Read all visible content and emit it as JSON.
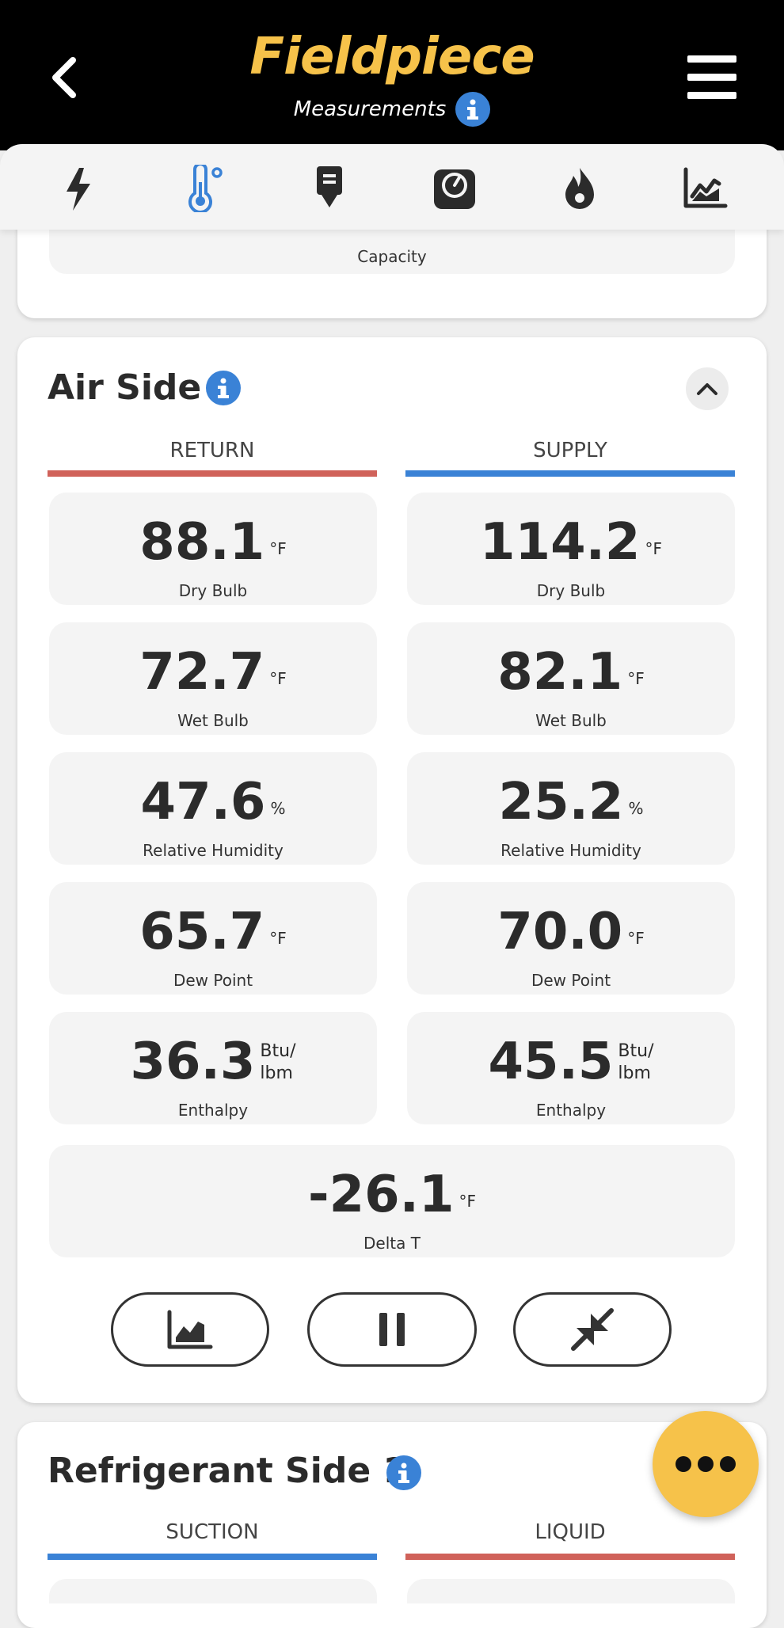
{
  "header": {
    "logo": "Fieldpiece",
    "subtitle": "Measurements"
  },
  "tabs": [
    {
      "icon": "lightning-icon",
      "active": false
    },
    {
      "icon": "thermometer-icon",
      "active": true
    },
    {
      "icon": "download-probe-icon",
      "active": false
    },
    {
      "icon": "gauge-icon",
      "active": false
    },
    {
      "icon": "flame-icon",
      "active": false
    },
    {
      "icon": "chart-icon",
      "active": false
    }
  ],
  "capacity": {
    "label": "Capacity"
  },
  "air_side": {
    "title": "Air Side",
    "return_label": "RETURN",
    "supply_label": "SUPPLY",
    "return": [
      {
        "value": "88.1",
        "unit": "°F",
        "label": "Dry Bulb"
      },
      {
        "value": "72.7",
        "unit": "°F",
        "label": "Wet Bulb"
      },
      {
        "value": "47.6",
        "unit": "%",
        "label": "Relative Humidity"
      },
      {
        "value": "65.7",
        "unit": "°F",
        "label": "Dew Point"
      },
      {
        "value": "36.3",
        "unit_line1": "Btu/",
        "unit_line2": "lbm",
        "label": "Enthalpy"
      }
    ],
    "supply": [
      {
        "value": "114.2",
        "unit": "°F",
        "label": "Dry Bulb"
      },
      {
        "value": "82.1",
        "unit": "°F",
        "label": "Wet Bulb"
      },
      {
        "value": "25.2",
        "unit": "%",
        "label": "Relative Humidity"
      },
      {
        "value": "70.0",
        "unit": "°F",
        "label": "Dew Point"
      },
      {
        "value": "45.5",
        "unit_line1": "Btu/",
        "unit_line2": "lbm",
        "label": "Enthalpy"
      }
    ],
    "delta": {
      "value": "-26.1",
      "unit": "°F",
      "label": "Delta T"
    }
  },
  "refrigerant_side": {
    "title": "Refrigerant Side 1",
    "suction_label": "SUCTION",
    "liquid_label": "LIQUID"
  },
  "colors": {
    "return": "#d0625a",
    "supply": "#3a82d6",
    "accent": "#f6c24a"
  }
}
